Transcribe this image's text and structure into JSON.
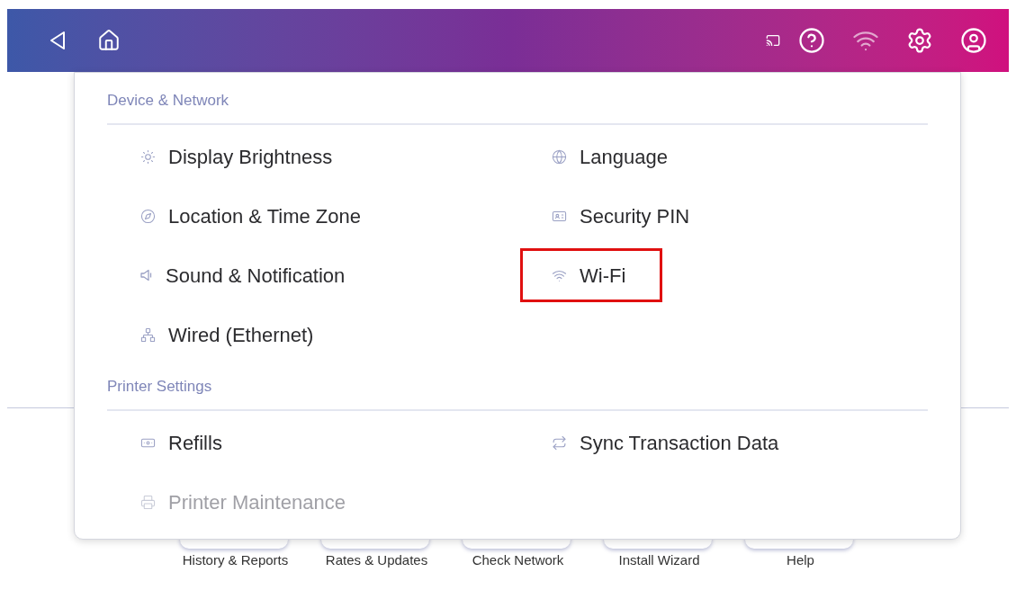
{
  "sections": [
    {
      "title": "Device & Network",
      "items": [
        {
          "label": "Display Brightness",
          "disabled": false,
          "highlighted": false
        },
        {
          "label": "Language",
          "disabled": false,
          "highlighted": false
        },
        {
          "label": "Location & Time Zone",
          "disabled": false,
          "highlighted": false
        },
        {
          "label": "Security PIN",
          "disabled": false,
          "highlighted": false
        },
        {
          "label": "Sound & Notification",
          "disabled": false,
          "highlighted": false
        },
        {
          "label": "Wi-Fi",
          "disabled": false,
          "highlighted": true
        },
        {
          "label": "Wired (Ethernet)",
          "disabled": false,
          "highlighted": false
        }
      ]
    },
    {
      "title": "Printer Settings",
      "items": [
        {
          "label": "Refills",
          "disabled": false,
          "highlighted": false
        },
        {
          "label": "Sync Transaction Data",
          "disabled": false,
          "highlighted": false
        },
        {
          "label": "Printer Maintenance",
          "disabled": true,
          "highlighted": false
        }
      ]
    }
  ],
  "bottom_tiles": [
    "History & Reports",
    "Rates & Updates",
    "Check Network",
    "Install Wizard",
    "Help"
  ]
}
